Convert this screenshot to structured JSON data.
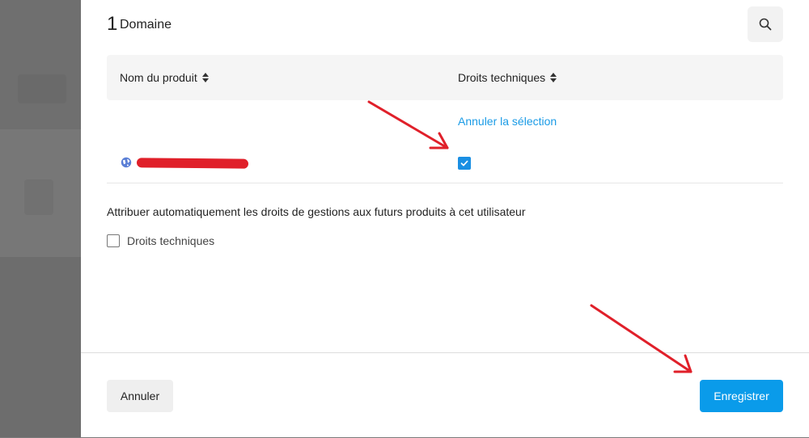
{
  "header": {
    "count": "1",
    "title": "Domaine",
    "search_icon": "search-icon"
  },
  "table": {
    "columns": [
      {
        "label": "Nom du produit",
        "sort_icon": "sort-icon"
      },
      {
        "label": "Droits techniques",
        "sort_icon": "sort-icon"
      }
    ],
    "clear_selection": "Annuler la sélection",
    "rows": [
      {
        "icon": "globe-icon",
        "name_redacted": true,
        "technical_rights_checked": true
      }
    ]
  },
  "auto_assign": {
    "label": "Attribuer automatiquement les droits de gestions aux futurs produits à cet utilisateur",
    "checkbox_label": "Droits techniques",
    "checked": false
  },
  "footer": {
    "cancel_label": "Annuler",
    "save_label": "Enregistrer"
  },
  "colors": {
    "accent": "#0a9bea",
    "link": "#1a9be6",
    "annotation": "#e0202a",
    "overlay": "#777777"
  }
}
